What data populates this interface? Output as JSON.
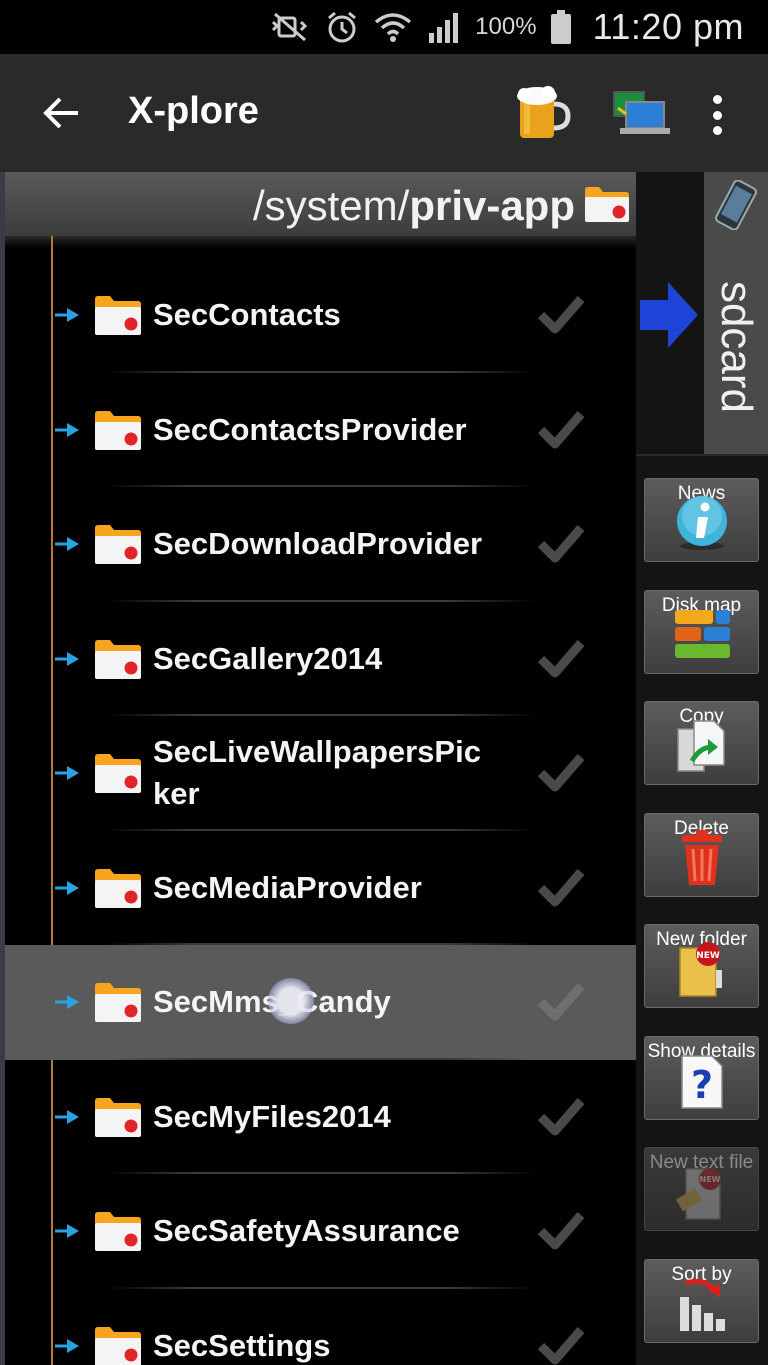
{
  "status_bar": {
    "battery_text": "100%",
    "time": "11:20 pm",
    "icons": [
      "mute-icon",
      "alarm-icon",
      "wifi-icon",
      "signal-icon",
      "battery-icon"
    ]
  },
  "app_bar": {
    "title": "X-plore",
    "actions": [
      "beer-icon",
      "computer-icon",
      "overflow-menu-icon"
    ]
  },
  "left_pane": {
    "path_prefix": "/system/",
    "path_current": "priv-app",
    "folders": [
      {
        "name": "SecContacts",
        "selected": false
      },
      {
        "name": "SecContactsProvider",
        "selected": false
      },
      {
        "name": "SecDownloadProvider",
        "selected": false
      },
      {
        "name": "SecGallery2014",
        "selected": false
      },
      {
        "name": "SecLiveWallpapersPicker",
        "selected": false
      },
      {
        "name": "SecMediaProvider",
        "selected": false
      },
      {
        "name": "SecMms_Candy",
        "selected": true
      },
      {
        "name": "SecMyFiles2014",
        "selected": false
      },
      {
        "name": "SecSafetyAssurance",
        "selected": false
      },
      {
        "name": "SecSettings",
        "selected": false
      }
    ]
  },
  "right_pane": {
    "storage_label": "sdcard",
    "tools": [
      {
        "label": "News",
        "icon": "info-icon",
        "enabled": true
      },
      {
        "label": "Disk map",
        "icon": "disk-map-icon",
        "enabled": true
      },
      {
        "label": "Copy",
        "icon": "copy-icon",
        "enabled": true
      },
      {
        "label": "Delete",
        "icon": "trash-icon",
        "enabled": true
      },
      {
        "label": "New folder",
        "icon": "new-folder-icon",
        "enabled": true
      },
      {
        "label": "Show details",
        "icon": "question-icon",
        "enabled": true
      },
      {
        "label": "New text file",
        "icon": "new-text-file-icon",
        "enabled": false
      },
      {
        "label": "Sort by",
        "icon": "sort-icon",
        "enabled": true
      }
    ]
  },
  "colors": {
    "app_bar": "#2a2a2a",
    "selected_row": "#5a5a5a",
    "tree_line": "#b57a36",
    "expand_arrow": "#29a3e0",
    "folder_dot": "#e0242a"
  }
}
